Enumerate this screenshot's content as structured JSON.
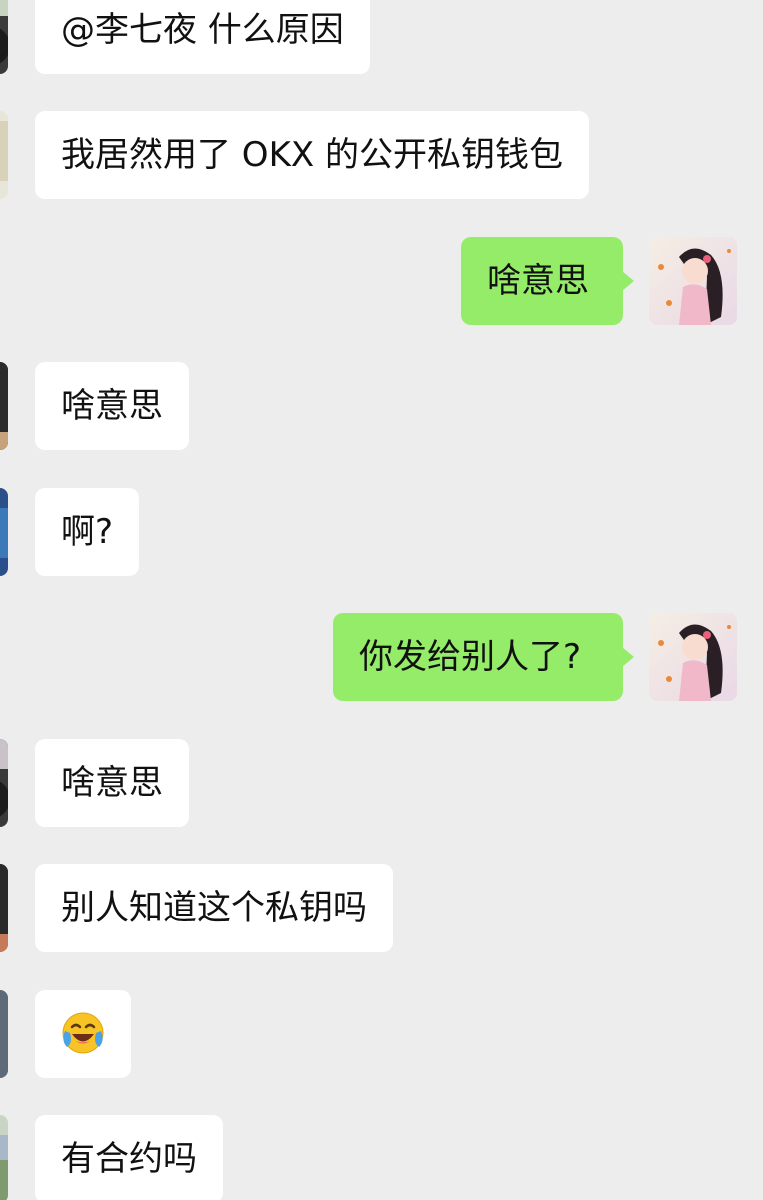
{
  "messages": [
    {
      "side": "left",
      "text": "@李七夜 什么原因",
      "avatar": "contact-avatar-dark"
    },
    {
      "side": "left",
      "text": "我居然用了 OKX 的公开私钥钱包",
      "avatar": "contact-avatar-light"
    },
    {
      "side": "right",
      "text": "啥意思",
      "avatar": "anime-girl-avatar"
    },
    {
      "side": "left",
      "text": "啥意思",
      "avatar": "contact-avatar-grey"
    },
    {
      "side": "left",
      "text": "啊?",
      "avatar": "contact-avatar-blue"
    },
    {
      "side": "right",
      "text": "你发给别人了?",
      "avatar": "anime-girl-avatar"
    },
    {
      "side": "left",
      "text": "啥意思",
      "avatar": "contact-avatar-dark"
    },
    {
      "side": "left",
      "text": "别人知道这个私钥吗",
      "avatar": "contact-avatar-grey"
    },
    {
      "side": "left",
      "text": "",
      "emoji": "laughing-crying-emoji",
      "avatar": "contact-avatar-slate"
    },
    {
      "side": "left",
      "text": "有合约吗",
      "avatar": "contact-avatar-landscape"
    }
  ],
  "colors": {
    "background": "#ededed",
    "incoming_bubble": "#ffffff",
    "outgoing_bubble": "#95ec69",
    "text": "#111111"
  }
}
